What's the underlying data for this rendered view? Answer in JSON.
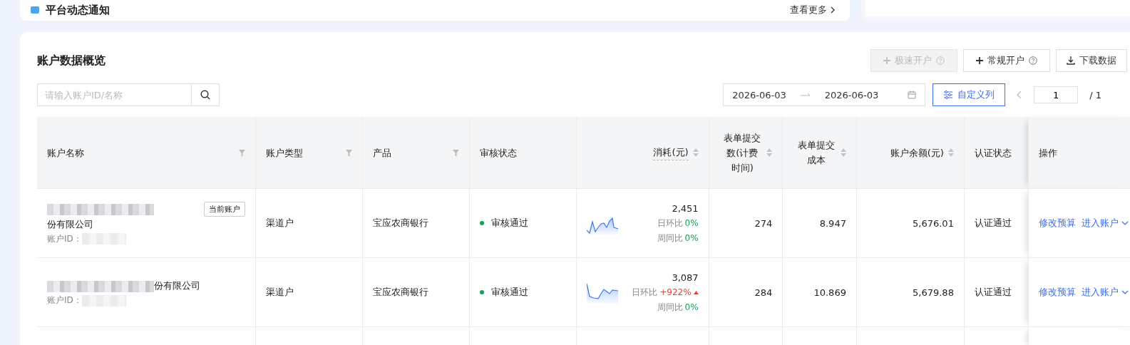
{
  "notice_card": {
    "title": "平台动态通知",
    "more_link": "查看更多"
  },
  "overview": {
    "title": "账户数据概览",
    "buttons": [
      {
        "label": "极速开户",
        "help": true,
        "disabled": true
      },
      {
        "label": "常规开户",
        "help": true,
        "disabled": false
      },
      {
        "label": "下载数据",
        "help": false,
        "disabled": false
      }
    ],
    "search": {
      "placeholder": "请输入账户ID/名称"
    },
    "date_range": {
      "start": "2026-06-03",
      "end": "2026-06-03"
    },
    "custom_columns_button": "自定义列",
    "pager": {
      "prev_disabled": true,
      "page": "1",
      "total": "/ 1"
    },
    "table": {
      "columns": [
        {
          "label": "账户名称",
          "filter": true,
          "sort": false
        },
        {
          "label": "账户类型",
          "filter": true,
          "sort": false
        },
        {
          "label": "产品",
          "filter": true,
          "sort": false
        },
        {
          "label": "审核状态",
          "filter": false,
          "sort": false
        },
        {
          "label": "消耗(元)",
          "filter": false,
          "sort": true,
          "tooltip": true
        },
        {
          "label": "表单提交数(计费时间)",
          "filter": false,
          "sort": true
        },
        {
          "label": "表单提交成本",
          "filter": false,
          "sort": true
        },
        {
          "label": "账户余额(元)",
          "filter": false,
          "sort": true
        },
        {
          "label": "认证状态",
          "filter": false,
          "sort": false
        },
        {
          "label": "操作",
          "filter": false,
          "sort": false
        }
      ],
      "rows": [
        {
          "name": "份有限公司",
          "current_badge": "当前账户",
          "id_label": "账户ID：",
          "type": "渠道户",
          "product": "宝应农商银行",
          "review": "审核通过",
          "spend": "2,451",
          "day_label": "日环比",
          "day_change": "0%",
          "day_rising": false,
          "week_label": "周同比",
          "week_change": "0%",
          "week_rising": false,
          "forms": "274",
          "cost": "8.947",
          "balance": "5,676.01",
          "cert": "认证通过",
          "actions": [
            "修改预算",
            "进入账户"
          ]
        },
        {
          "name": "份有限公司",
          "id_label": "账户ID：",
          "type": "渠道户",
          "product": "宝应农商银行",
          "review": "审核通过",
          "spend": "3,087",
          "day_label": "日环比",
          "day_change": "+922%",
          "day_rising": true,
          "week_label": "周同比",
          "week_change": "0%",
          "week_rising": false,
          "forms": "284",
          "cost": "10.869",
          "balance": "5,679.88",
          "cert": "认证通过",
          "actions": [
            "修改预算",
            "进入账户"
          ]
        }
      ]
    }
  }
}
